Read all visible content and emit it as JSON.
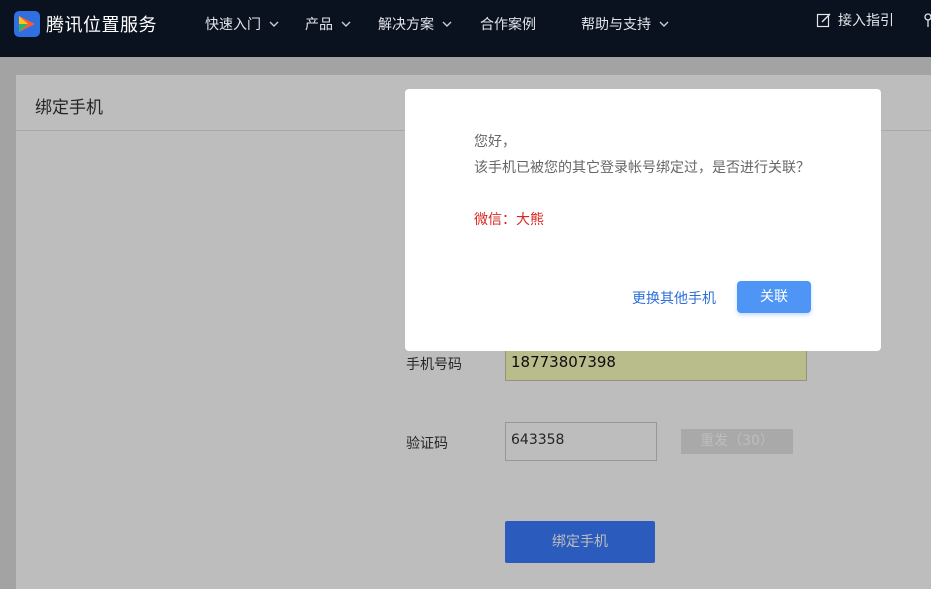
{
  "header": {
    "brand": "腾讯位置服务",
    "nav": [
      "快速入门",
      "产品",
      "解决方案",
      "合作案例",
      "帮助与支持"
    ],
    "guide": "接入指引"
  },
  "page": {
    "title": "绑定手机",
    "phone_label": "手机号码",
    "phone_value": "18773807398",
    "code_label": "验证码",
    "code_value": "643358",
    "resend": "重发（30）",
    "bind_button": "绑定手机"
  },
  "dialog": {
    "greeting": "您好，",
    "message": "该手机已被您的其它登录帐号绑定过，是否进行关联？",
    "wechat": "微信：大熊",
    "change_phone": "更换其他手机",
    "link": "关联"
  }
}
